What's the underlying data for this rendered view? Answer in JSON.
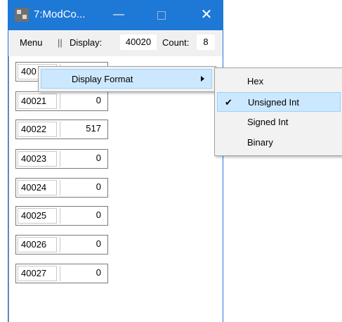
{
  "window": {
    "title": "7:ModCo..."
  },
  "toolbar": {
    "menu_label": "Menu",
    "separator": "||",
    "display_label": "Display:",
    "display_value": "40020",
    "count_label": "Count:",
    "count_value": "8"
  },
  "registers": [
    {
      "address": "400",
      "value": ""
    },
    {
      "address": "40021",
      "value": "0"
    },
    {
      "address": "40022",
      "value": "517"
    },
    {
      "address": "40023",
      "value": "0"
    },
    {
      "address": "40024",
      "value": "0"
    },
    {
      "address": "40025",
      "value": "0"
    },
    {
      "address": "40026",
      "value": "0"
    },
    {
      "address": "40027",
      "value": "0"
    }
  ],
  "context_menu": {
    "item": "Display Format",
    "submenu": [
      {
        "label": "Hex",
        "checked": false
      },
      {
        "label": "Unsigned Int",
        "checked": true
      },
      {
        "label": "Signed Int",
        "checked": false
      },
      {
        "label": "Binary",
        "checked": false
      }
    ]
  }
}
